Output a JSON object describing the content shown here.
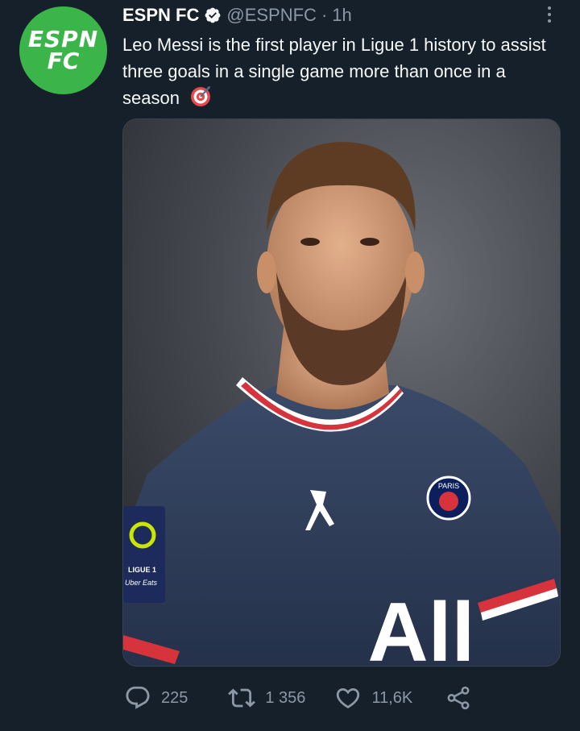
{
  "tweet": {
    "author": {
      "avatar_line1": "ESPN",
      "avatar_line2": "FC",
      "name": "ESPN FC",
      "handle": "@ESPNFC",
      "separator": "·",
      "time": "1h"
    },
    "text": "Leo Messi is the first player in Ligue 1 history to assist three goals in a single game more than once in a season",
    "emoji": "direct-hit-target-emoji",
    "media": {
      "jersey_text": "All",
      "badge_text": "PARIS",
      "league_patch_line1": "LIGUE 1",
      "league_patch_line2": "Uber Eats"
    },
    "stats": {
      "replies": "225",
      "retweets": "1 356",
      "likes": "11,6K"
    }
  },
  "icons": {
    "verified": "verified-badge-icon",
    "more": "more-options-icon",
    "reply": "reply-icon",
    "retweet": "retweet-icon",
    "like": "heart-icon",
    "share": "share-icon"
  },
  "colors": {
    "background": "#15202b",
    "text_primary": "#f7f9f9",
    "text_secondary": "#8b98a5",
    "avatar_green": "#3bb54a",
    "jersey_navy": "#2e3e5c",
    "collar_red": "#d6333c"
  }
}
